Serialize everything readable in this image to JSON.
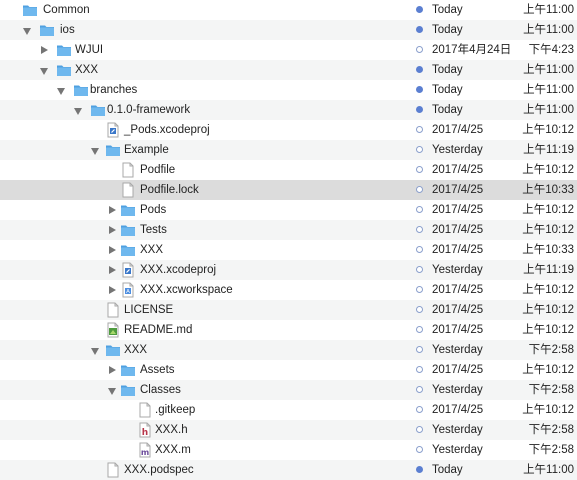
{
  "rows": [
    {
      "name": "Common",
      "icon": "folder-icon",
      "disclosure": "none",
      "status": "synced",
      "date": "Today",
      "time": "上午11:00"
    },
    {
      "name": "ios",
      "icon": "folder-icon",
      "disclosure": "open",
      "status": "synced",
      "date": "Today",
      "time": "上午11:00"
    },
    {
      "name": "WJUI",
      "icon": "folder-icon",
      "disclosure": "closed",
      "status": "pending",
      "date": "2017年4月24日",
      "time": "下午4:23"
    },
    {
      "name": "XXX",
      "icon": "folder-icon",
      "disclosure": "open",
      "status": "synced",
      "date": "Today",
      "time": "上午11:00"
    },
    {
      "name": "branches",
      "icon": "folder-icon",
      "disclosure": "open",
      "status": "synced",
      "date": "Today",
      "time": "上午11:00"
    },
    {
      "name": "0.1.0-framework",
      "icon": "folder-icon",
      "disclosure": "open",
      "status": "synced",
      "date": "Today",
      "time": "上午11:00"
    },
    {
      "name": "_Pods.xcodeproj",
      "icon": "xcodeproj-icon",
      "disclosure": "none",
      "status": "pending",
      "date": "2017/4/25",
      "time": "上午10:12"
    },
    {
      "name": "Example",
      "icon": "folder-icon",
      "disclosure": "open",
      "status": "pending",
      "date": "Yesterday",
      "time": "上午11:19"
    },
    {
      "name": "Podfile",
      "icon": "document-icon",
      "disclosure": "none",
      "status": "pending",
      "date": "2017/4/25",
      "time": "上午10:12"
    },
    {
      "name": "Podfile.lock",
      "icon": "document-icon",
      "disclosure": "none",
      "status": "pending",
      "date": "2017/4/25",
      "time": "上午10:33",
      "selected": true
    },
    {
      "name": "Pods",
      "icon": "folder-icon",
      "disclosure": "closed",
      "status": "pending",
      "date": "2017/4/25",
      "time": "上午10:12"
    },
    {
      "name": "Tests",
      "icon": "folder-icon",
      "disclosure": "closed",
      "status": "pending",
      "date": "2017/4/25",
      "time": "上午10:12"
    },
    {
      "name": "XXX",
      "icon": "folder-icon",
      "disclosure": "closed",
      "status": "pending",
      "date": "2017/4/25",
      "time": "上午10:33"
    },
    {
      "name": "XXX.xcodeproj",
      "icon": "xcodeproj-icon",
      "disclosure": "closed",
      "status": "pending",
      "date": "Yesterday",
      "time": "上午11:19"
    },
    {
      "name": "XXX.xcworkspace",
      "icon": "xcworkspace-icon",
      "disclosure": "closed",
      "status": "pending",
      "date": "2017/4/25",
      "time": "上午10:12"
    },
    {
      "name": "LICENSE",
      "icon": "document-icon",
      "disclosure": "none",
      "status": "pending",
      "date": "2017/4/25",
      "time": "上午10:12"
    },
    {
      "name": "README.md",
      "icon": "markdown-file-icon",
      "disclosure": "none",
      "status": "pending",
      "date": "2017/4/25",
      "time": "上午10:12"
    },
    {
      "name": "XXX",
      "icon": "folder-icon",
      "disclosure": "open",
      "status": "pending",
      "date": "Yesterday",
      "time": "下午2:58"
    },
    {
      "name": "Assets",
      "icon": "folder-icon",
      "disclosure": "closed",
      "status": "pending",
      "date": "2017/4/25",
      "time": "上午10:12"
    },
    {
      "name": "Classes",
      "icon": "folder-icon",
      "disclosure": "open",
      "status": "pending",
      "date": "Yesterday",
      "time": "下午2:58"
    },
    {
      "name": ".gitkeep",
      "icon": "document-icon",
      "disclosure": "none",
      "status": "pending",
      "date": "2017/4/25",
      "time": "上午10:12"
    },
    {
      "name": "XXX.h",
      "icon": "header-file-icon",
      "disclosure": "none",
      "status": "pending",
      "date": "Yesterday",
      "time": "下午2:58"
    },
    {
      "name": "XXX.m",
      "icon": "objc-file-icon",
      "disclosure": "none",
      "status": "pending",
      "date": "Yesterday",
      "time": "下午2:58"
    },
    {
      "name": "XXX.podspec",
      "icon": "document-icon",
      "disclosure": "none",
      "status": "synced",
      "date": "Today",
      "time": "上午11:00"
    }
  ],
  "colors": {
    "folder": "#6fb8ee",
    "folder_dark": "#4fa0e0",
    "row_alt": "#f4f5f5",
    "row_selected": "#dcdcdc",
    "status_synced": "#5b7fd1",
    "status_pending_border": "#8a9fcc"
  }
}
